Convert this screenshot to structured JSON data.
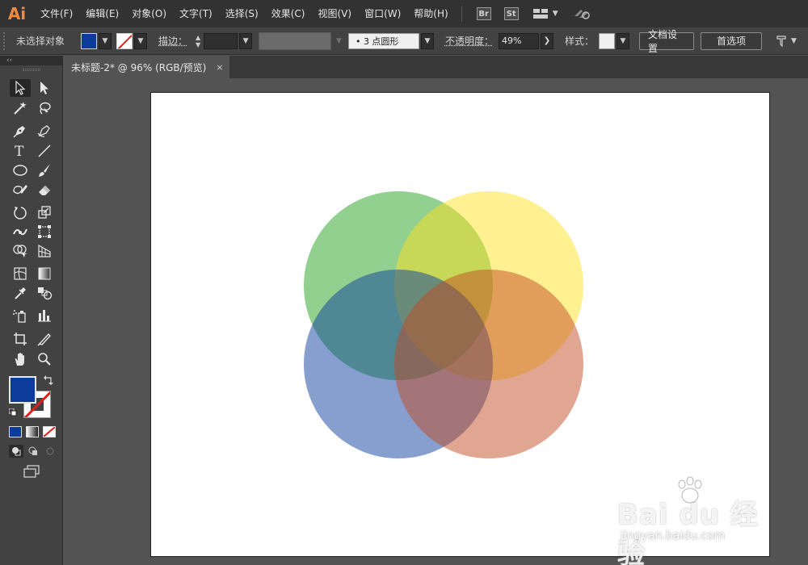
{
  "app": {
    "logo_text": "Ai"
  },
  "menu": {
    "items": [
      {
        "key": "file",
        "label": "文件(F)"
      },
      {
        "key": "edit",
        "label": "编辑(E)"
      },
      {
        "key": "object",
        "label": "对象(O)"
      },
      {
        "key": "type",
        "label": "文字(T)"
      },
      {
        "key": "select",
        "label": "选择(S)"
      },
      {
        "key": "effect",
        "label": "效果(C)"
      },
      {
        "key": "view",
        "label": "视图(V)"
      },
      {
        "key": "window",
        "label": "窗口(W)"
      },
      {
        "key": "help",
        "label": "帮助(H)"
      }
    ],
    "bridge_label": "Br",
    "stock_label": "St"
  },
  "control_bar": {
    "selection_status": "未选择对象",
    "fill_color": "#0b3c9c",
    "stroke_label": "描边：",
    "brush_value": "• 3 点圆形",
    "opacity_label": "不透明度：",
    "opacity_value": "49%",
    "style_label": "样式：",
    "doc_setup_button": "文档设置",
    "preferences_button": "首选项"
  },
  "panel": {
    "collapse_label": "‹‹"
  },
  "tabs": [
    {
      "label": "未标题-2* @ 96% (RGB/预览)",
      "close": "×"
    }
  ],
  "tools": [
    "selection-tool",
    "direct-selection-tool",
    "magic-wand-tool",
    "lasso-tool",
    "pen-tool",
    "curvature-tool",
    "type-tool",
    "line-segment-tool",
    "ellipse-tool",
    "paintbrush-tool",
    "shaper-tool",
    "eraser-tool",
    "rotate-tool",
    "scale-tool",
    "width-tool",
    "free-transform-tool",
    "shape-builder-tool",
    "perspective-grid-tool",
    "mesh-tool",
    "gradient-tool",
    "eyedropper-tool",
    "blend-tool",
    "symbol-sprayer-tool",
    "column-graph-tool",
    "artboard-tool",
    "slice-tool",
    "hand-tool",
    "zoom-tool"
  ],
  "artwork": {
    "circles": [
      {
        "name": "green-circle",
        "color": "#1ea01a"
      },
      {
        "name": "yellow-circle",
        "color": "#ffe020"
      },
      {
        "name": "blue-circle",
        "color": "#0b3c9c"
      },
      {
        "name": "orange-circle",
        "color": "#c04a20"
      }
    ],
    "opacity": 0.49
  },
  "watermark": {
    "brand": "Bai du 经验",
    "url": "jingyan.baidu.com"
  }
}
